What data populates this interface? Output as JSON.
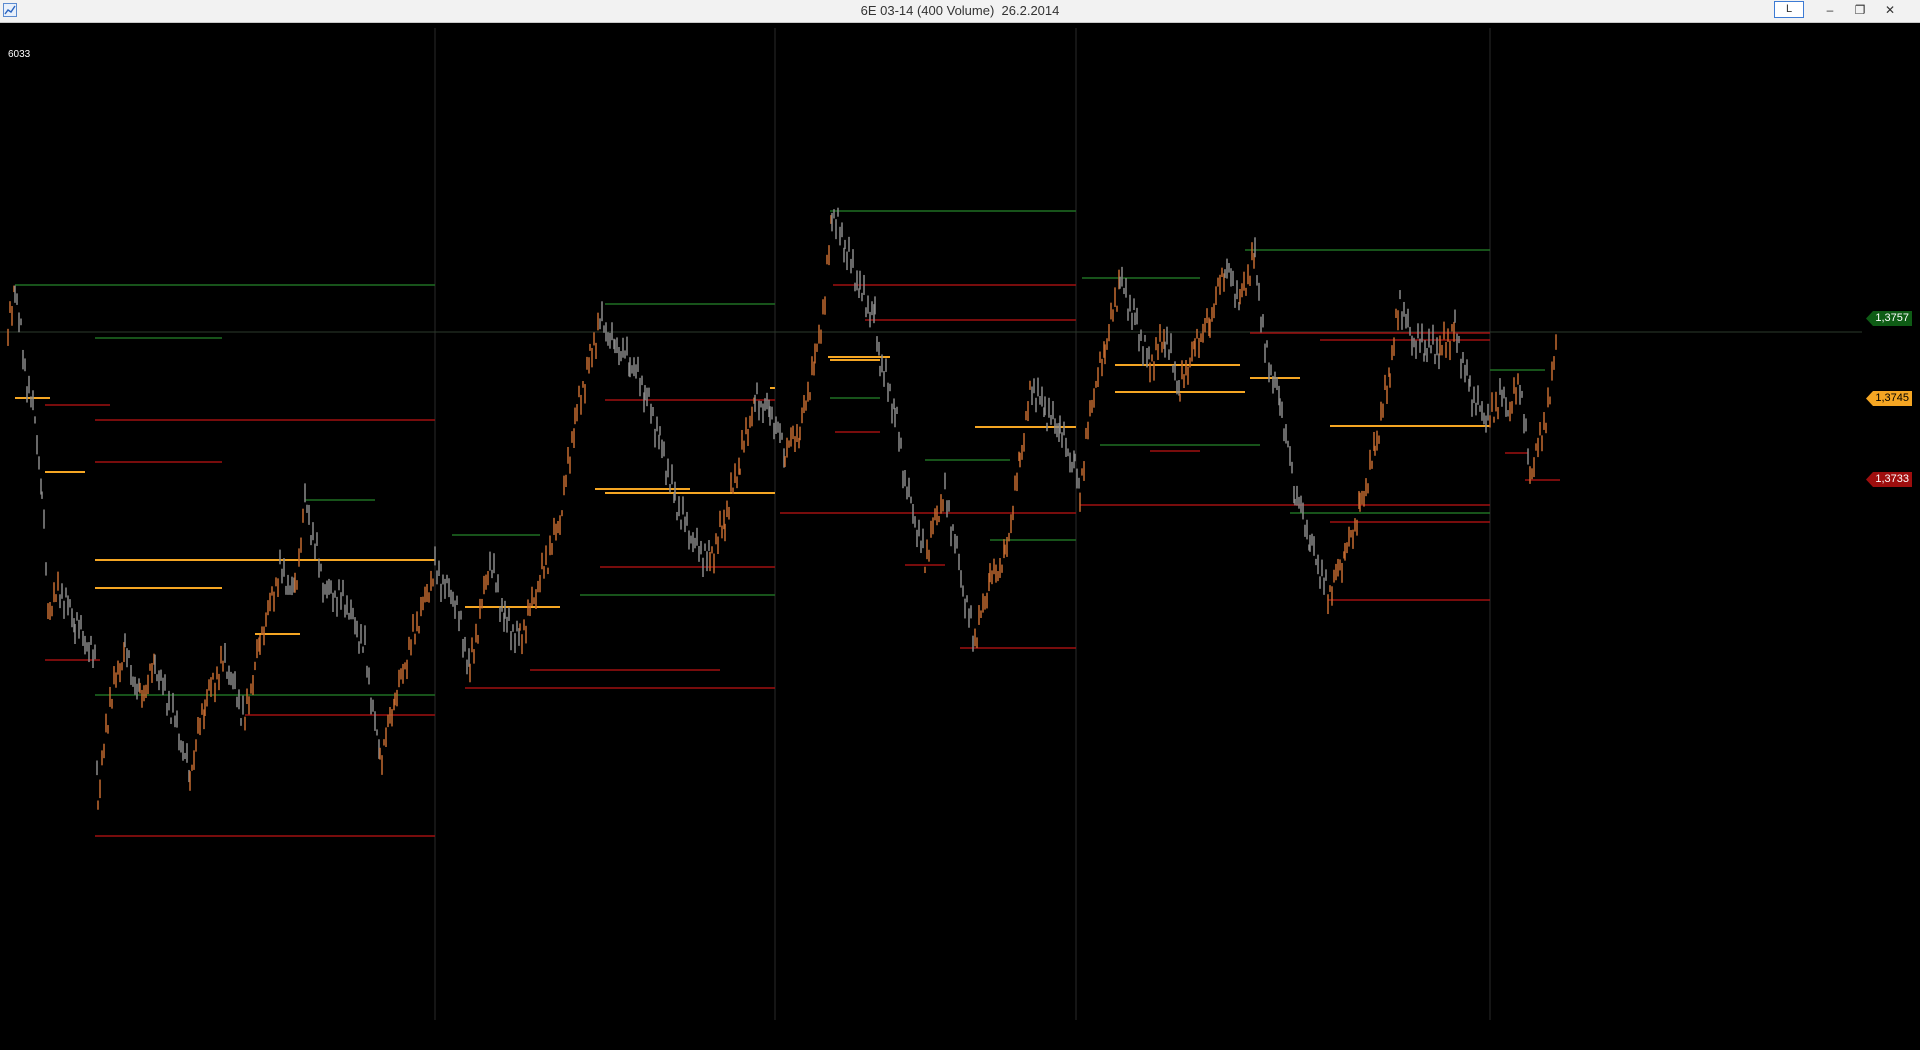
{
  "window": {
    "title": "6E 03-14 (400 Volume)  26.2.2014",
    "toggle_label": "L",
    "controls": {
      "minimize": "–",
      "restore": "❐",
      "close": "✕"
    }
  },
  "chart": {
    "volume_label": "6033",
    "background": "#000000",
    "price_tags": [
      {
        "name": "high",
        "value": "1,3757",
        "bg": "#0e5c15",
        "fg": "#ffffff"
      },
      {
        "name": "mid",
        "value": "1,3745",
        "bg": "#f5a623",
        "fg": "#000000"
      },
      {
        "name": "low",
        "value": "1,3733",
        "bg": "#9e0e0e",
        "fg": "#ffffff"
      }
    ],
    "colors": {
      "bar_gray": "#8a8a8a",
      "bar_orange": "#c46a30",
      "level_green": "#1f6f22",
      "level_red": "#a01010",
      "level_orange": "#f5a623",
      "session_divider": "#2a2a2a"
    }
  }
}
